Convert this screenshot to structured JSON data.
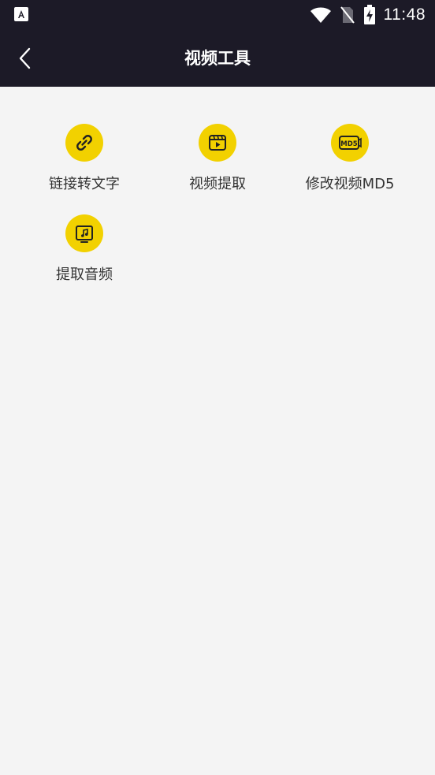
{
  "status_bar": {
    "time": "11:48",
    "icons": [
      "app-notification-icon",
      "wifi-icon",
      "no-sim-icon",
      "battery-charging-icon"
    ]
  },
  "header": {
    "title": "视频工具",
    "back_icon": "chevron-left-icon"
  },
  "tools": [
    {
      "label": "链接转文字",
      "icon": "link-icon"
    },
    {
      "label": "视频提取",
      "icon": "video-play-icon"
    },
    {
      "label": "修改视频MD5",
      "icon": "md5-icon"
    },
    {
      "label": "提取音频",
      "icon": "music-icon"
    }
  ],
  "colors": {
    "header_bg": "#1c1a27",
    "accent": "#f2d100",
    "page_bg": "#f4f4f4"
  }
}
